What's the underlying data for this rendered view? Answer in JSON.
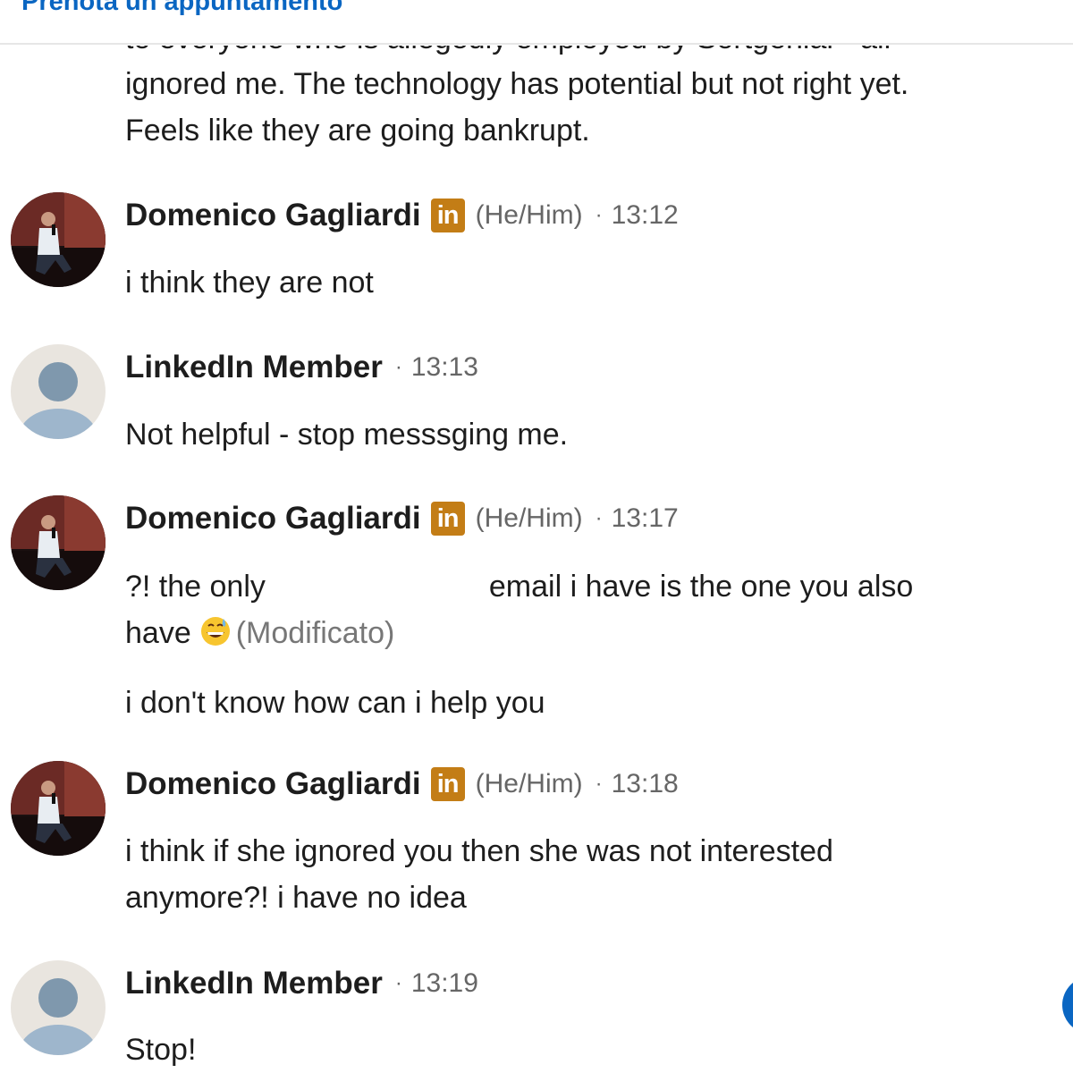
{
  "top_bar": {
    "link_label": "Prenota un appuntamento"
  },
  "previous_message": {
    "clipped_line": "to everyone who is allegedly employed by Sortgenial - all",
    "line_1": "ignored me. The technology has potential but not right yet.",
    "line_2": "Feels like they are going bankrupt."
  },
  "messages": [
    {
      "sender": "Domenico Gagliardi",
      "badge": "in",
      "pronouns": "(He/Him)",
      "separator": "·",
      "time": "13:12",
      "lines": [
        "i think they are not"
      ]
    },
    {
      "sender": "LinkedIn Member",
      "separator": "·",
      "time": "13:13",
      "lines": [
        "Not helpful - stop messsging me."
      ]
    },
    {
      "sender": "Domenico Gagliardi",
      "badge": "in",
      "pronouns": "(He/Him)",
      "separator": "·",
      "time": "13:17",
      "line_1_start": "?! the only",
      "line_1_end": "email i have is the one you also",
      "line_2_start": "have",
      "edited_label": "(Modificato)",
      "line_3": "i don't know how can i help you"
    },
    {
      "sender": "Domenico Gagliardi",
      "badge": "in",
      "pronouns": "(He/Him)",
      "separator": "·",
      "time": "13:18",
      "lines": [
        "i think if she ignored you then she was not interested",
        "anymore?! i have no idea"
      ]
    },
    {
      "sender": "LinkedIn Member",
      "separator": "·",
      "time": "13:19",
      "lines": [
        "Stop!"
      ]
    }
  ],
  "icons": {
    "profile_photo": "profile-photo-icon",
    "default_avatar": "default-avatar-icon",
    "linkedin_badge": "linkedin-badge-icon",
    "emoji": "grinning-sweat-emoji-icon"
  },
  "colors": {
    "link_blue": "#0a66c2",
    "badge_gold": "#c37d16",
    "meta_gray": "#666666",
    "avatar_bg": "#e9e5df",
    "avatar_person": "#7f98ad"
  }
}
